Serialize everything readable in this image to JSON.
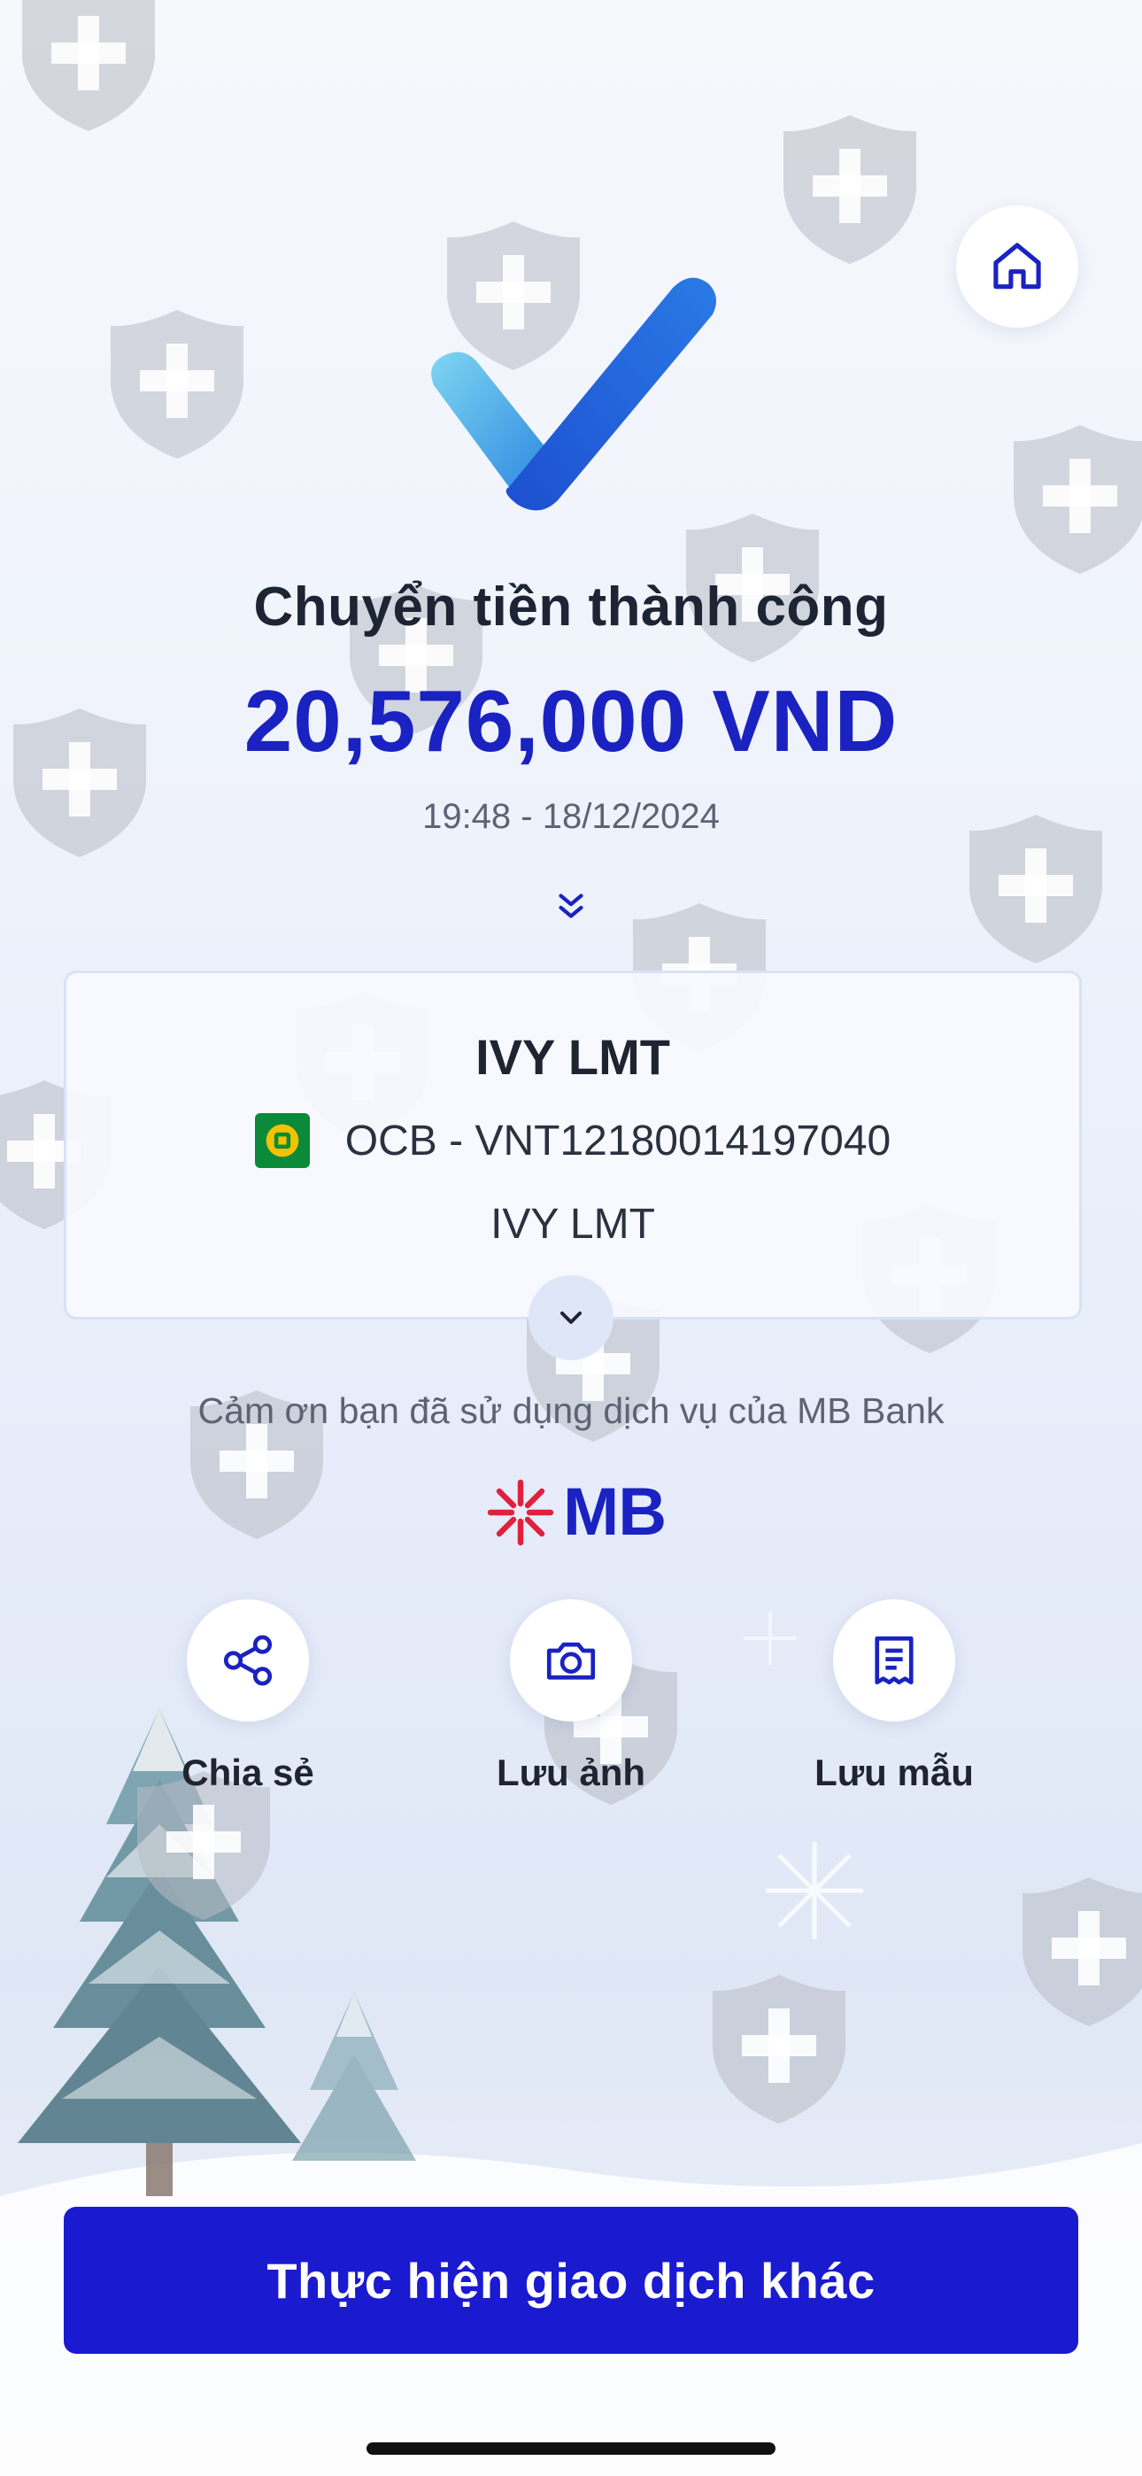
{
  "header": {
    "home_icon": "home-icon"
  },
  "result": {
    "title": "Chuyển tiền thành công",
    "amount": "20,576,000 VND",
    "datetime": "19:48 - 18/12/2024"
  },
  "recipient": {
    "name": "IVY LMT",
    "bank_account": "OCB - VNT12180014197040",
    "account_holder": "IVY LMT"
  },
  "footer_note": "Cảm ơn bạn đã sử dụng dịch vụ của MB Bank",
  "brand": {
    "logo_text": "MB",
    "primary_color": "#1a22c2",
    "accent_red": "#e0203c"
  },
  "actions": [
    {
      "label": "Chia sẻ",
      "icon": "share-icon"
    },
    {
      "label": "Lưu ảnh",
      "icon": "camera-icon"
    },
    {
      "label": "Lưu mẫu",
      "icon": "receipt-icon"
    }
  ],
  "primary_button": {
    "label": "Thực hiện giao dịch khác"
  }
}
